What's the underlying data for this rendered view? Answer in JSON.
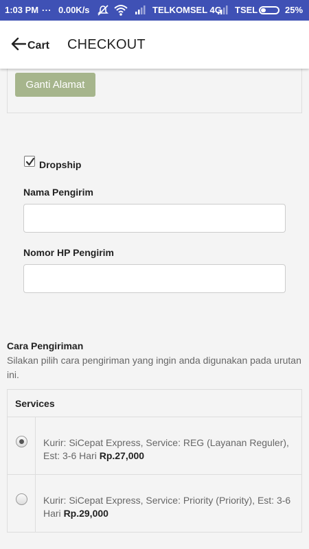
{
  "status_bar": {
    "time": "1:03 PM",
    "dots": "...",
    "speed": "0.00K/s",
    "carrier1": "TELKOMSEL 4G",
    "carrier2": "TSEL",
    "battery": "25%",
    "colors": {
      "background": "#3f51b5"
    }
  },
  "app_bar": {
    "back_label": "Cart",
    "title": "CHECKOUT"
  },
  "address": {
    "change_button": "Ganti Alamat",
    "colors": {
      "button": "#a6b58c"
    }
  },
  "dropship": {
    "checked": true,
    "label": "Dropship",
    "sender_name_label": "Nama Pengirim",
    "sender_name_value": "",
    "sender_phone_label": "Nomor HP Pengirim",
    "sender_phone_value": ""
  },
  "shipping": {
    "title": "Cara Pengiriman",
    "description": "Silakan pilih cara pengiriman yang ingin anda digunakan pada urutan ini.",
    "table_header": "Services",
    "options": [
      {
        "selected": true,
        "text": "Kurir: SiCepat Express, Service: REG (Layanan Reguler), Est: 3-6 Hari",
        "price": "Rp.27,000"
      },
      {
        "selected": false,
        "text": "Kurir: SiCepat Express, Service: Priority (Priority), Est: 3-6 Hari",
        "price": "Rp.29,000"
      }
    ]
  }
}
